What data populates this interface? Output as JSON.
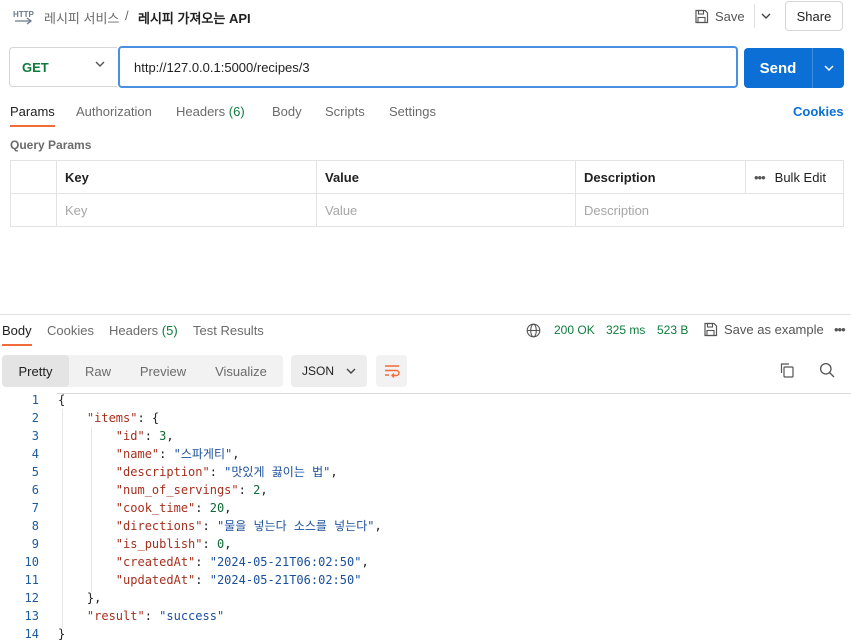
{
  "breadcrumb": {
    "parent": "레시피 서비스",
    "separator": "/",
    "title": "레시피 가져오는 API"
  },
  "toolbar": {
    "save_label": "Save",
    "share_label": "Share"
  },
  "request": {
    "method": "GET",
    "url": "http://127.0.0.1:5000/recipes/3",
    "send_label": "Send"
  },
  "request_tabs": [
    {
      "label": "Params"
    },
    {
      "label": "Authorization"
    },
    {
      "label": "Headers",
      "count": "(6)"
    },
    {
      "label": "Body"
    },
    {
      "label": "Scripts"
    },
    {
      "label": "Settings"
    }
  ],
  "cookies_label": "Cookies",
  "query_params": {
    "title": "Query Params",
    "headers": {
      "key": "Key",
      "value": "Value",
      "description": "Description",
      "bulk_edit": "Bulk Edit"
    },
    "placeholders": {
      "key": "Key",
      "value": "Value",
      "description": "Description"
    }
  },
  "response_tabs": [
    {
      "label": "Body"
    },
    {
      "label": "Cookies"
    },
    {
      "label": "Headers",
      "count": "(5)"
    },
    {
      "label": "Test Results"
    }
  ],
  "response_status": {
    "status": "200 OK",
    "time": "325 ms",
    "size": "523 B",
    "save_example": "Save as example"
  },
  "view_modes": [
    "Pretty",
    "Raw",
    "Preview",
    "Visualize"
  ],
  "format": "JSON",
  "colors": {
    "accent": "#f26b3a",
    "send": "#0b6fd6",
    "status_ok": "#0f7b3d",
    "url_border": "#4a90e2"
  },
  "response_body": [
    {
      "n": "1",
      "t": "{"
    },
    {
      "n": "2",
      "t": "    \"items\": {"
    },
    {
      "n": "3",
      "t": "        \"id\": 3,"
    },
    {
      "n": "4",
      "t": "        \"name\": \"스파게티\","
    },
    {
      "n": "5",
      "t": "        \"description\": \"맛있게 끓이는 법\","
    },
    {
      "n": "6",
      "t": "        \"num_of_servings\": 2,"
    },
    {
      "n": "7",
      "t": "        \"cook_time\": 20,"
    },
    {
      "n": "8",
      "t": "        \"directions\": \"물을 넣는다 소스를 넣는다\","
    },
    {
      "n": "9",
      "t": "        \"is_publish\": 0,"
    },
    {
      "n": "10",
      "t": "        \"createdAt\": \"2024-05-21T06:02:50\","
    },
    {
      "n": "11",
      "t": "        \"updatedAt\": \"2024-05-21T06:02:50\""
    },
    {
      "n": "12",
      "t": "    },"
    },
    {
      "n": "13",
      "t": "    \"result\": \"success\""
    },
    {
      "n": "14",
      "t": "}"
    }
  ]
}
